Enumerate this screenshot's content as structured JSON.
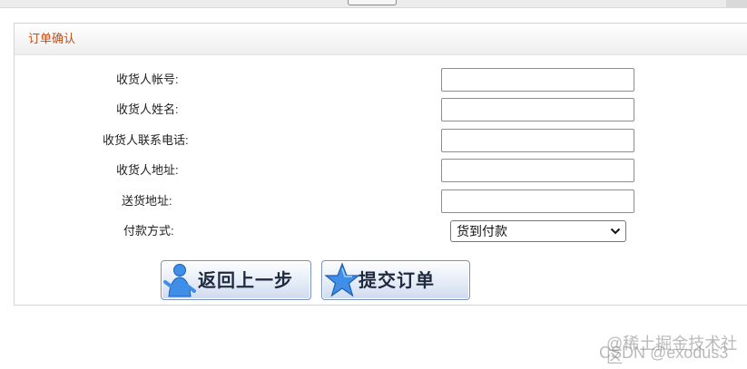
{
  "panel": {
    "title": "订单确认"
  },
  "form": {
    "fields": [
      {
        "label": "收货人帐号:",
        "value": ""
      },
      {
        "label": "收货人姓名:",
        "value": ""
      },
      {
        "label": "收货人联系电话:",
        "value": ""
      },
      {
        "label": "收货人地址:",
        "value": ""
      },
      {
        "label": "送货地址:",
        "value": ""
      }
    ],
    "payment": {
      "label": "付款方式:",
      "selected": "货到付款"
    }
  },
  "buttons": {
    "back": "返回上一步",
    "submit": "提交订单"
  },
  "watermark": {
    "line1": "@稀土掘金技术社区",
    "line2": "CSDN @exodus3"
  },
  "colors": {
    "title": "#c0501a",
    "button_border": "#7b92b8"
  }
}
